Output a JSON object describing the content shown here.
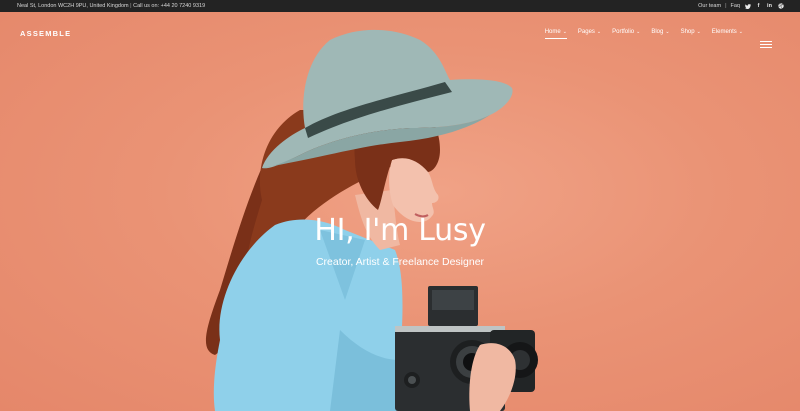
{
  "topbar": {
    "address": "Neal St, London WC2H 9PU, United Kingdom",
    "call_label": "Call us on:",
    "phone": "+44 20 7240 9319",
    "our_team": "Our team",
    "faq": "Faq",
    "social_icons": [
      "twitter-icon",
      "facebook-icon",
      "linkedin-icon",
      "dribbble-icon"
    ]
  },
  "nav": {
    "logo": "ASSEMBLE",
    "items": [
      {
        "label": "Home",
        "active": true
      },
      {
        "label": "Pages"
      },
      {
        "label": "Portfolio"
      },
      {
        "label": "Blog"
      },
      {
        "label": "Shop"
      },
      {
        "label": "Elements"
      }
    ],
    "menu_icon": "hamburger-icon"
  },
  "hero": {
    "title": "HI, I'm Lusy",
    "subtitle": "Creator, Artist & Freelance Designer"
  },
  "colors": {
    "background": "#e98f72",
    "topbar": "#232323",
    "shirt": "#8fd0ea",
    "hat": "#9fb8b6",
    "hair": "#7a3018"
  }
}
